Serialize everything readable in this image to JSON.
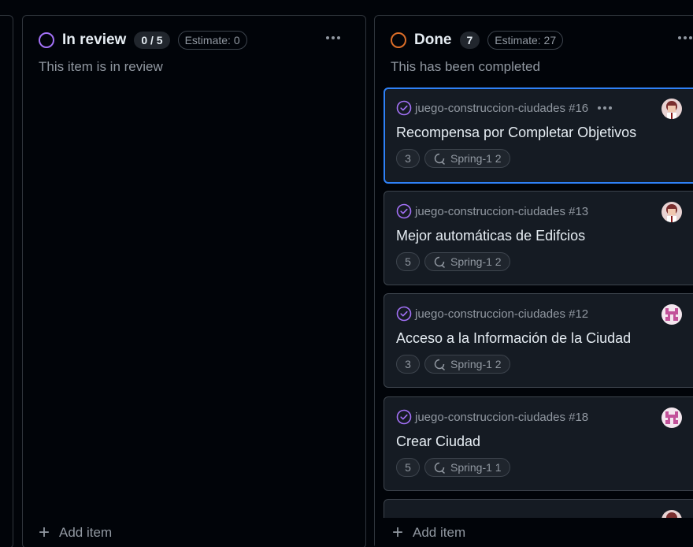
{
  "columns": {
    "review": {
      "title": "In review",
      "count": "0 / 5",
      "estimate": "Estimate: 0",
      "description": "This item is in review",
      "add_item": "Add item",
      "status_color": "#a371f7"
    },
    "done": {
      "title": "Done",
      "count": "7",
      "estimate": "Estimate: 27",
      "description": "This has been completed",
      "add_item": "Add item",
      "status_color": "#db6d28"
    }
  },
  "cards": [
    {
      "ref": "juego-construccion-ciudades #16",
      "title": "Recompensa por Completar Objetivos",
      "points": "3",
      "sprint": "Spring-1 2",
      "selected": true,
      "avatar": "avatar-a"
    },
    {
      "ref": "juego-construccion-ciudades #13",
      "title": "Mejor automáticas de Edifcios",
      "points": "5",
      "sprint": "Spring-1 2",
      "avatar": "avatar-a"
    },
    {
      "ref": "juego-construccion-ciudades #12",
      "title": "Acceso a la Información de la Ciudad",
      "points": "3",
      "sprint": "Spring-1 2",
      "avatar": "avatar-b"
    },
    {
      "ref": "juego-construccion-ciudades #18",
      "title": "Crear Ciudad",
      "points": "5",
      "sprint": "Spring-1 1",
      "avatar": "avatar-b"
    }
  ],
  "icons": {
    "done": "circle-check-icon",
    "iteration": "iteration-icon",
    "more": "kebab-horizontal-icon",
    "add": "plus-icon"
  },
  "colors": {
    "background": "#010409",
    "card": "#151b23",
    "selected_border": "#2f81f7",
    "done_purple": "#a371f7"
  }
}
